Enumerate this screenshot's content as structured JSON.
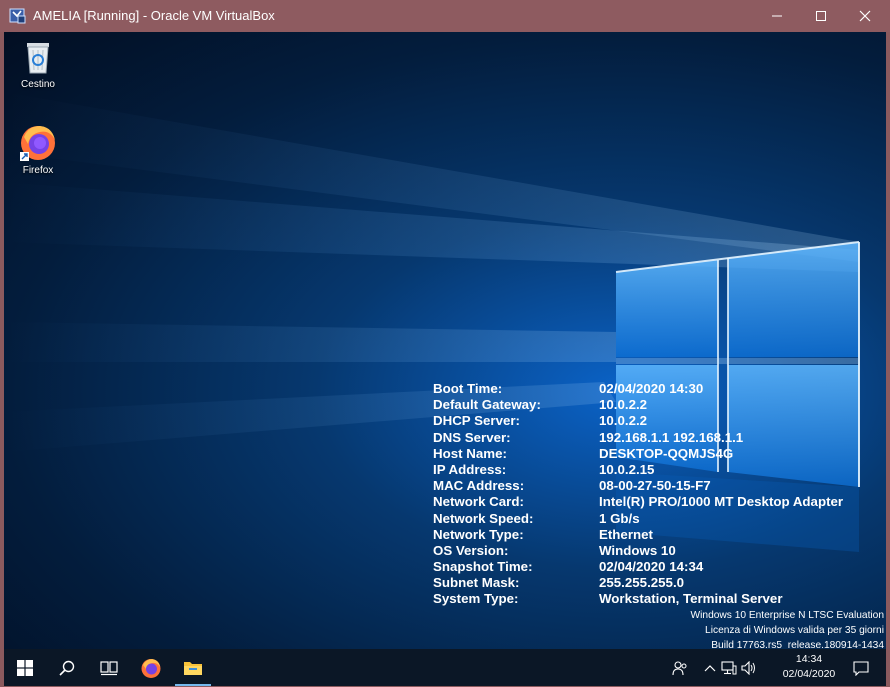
{
  "window": {
    "title": "AMELIA [Running] - Oracle VM VirtualBox",
    "titlebar_color": "#8e5b60"
  },
  "desktop": {
    "icons": [
      {
        "label": "Cestino",
        "icon": "recycle-bin-icon"
      },
      {
        "label": "Firefox",
        "icon": "firefox-icon"
      }
    ]
  },
  "bginfo": {
    "rows": [
      {
        "key": "Boot Time:",
        "value": "02/04/2020 14:30"
      },
      {
        "key": "Default Gateway:",
        "value": "10.0.2.2"
      },
      {
        "key": "DHCP Server:",
        "value": "10.0.2.2"
      },
      {
        "key": "DNS Server:",
        "value": "192.168.1.1 192.168.1.1"
      },
      {
        "key": "Host Name:",
        "value": "DESKTOP-QQMJS4G"
      },
      {
        "key": "IP Address:",
        "value": "10.0.2.15"
      },
      {
        "key": "MAC Address:",
        "value": "08-00-27-50-15-F7"
      },
      {
        "key": "Network Card:",
        "value": "Intel(R) PRO/1000 MT Desktop Adapter"
      },
      {
        "key": "Network Speed:",
        "value": "1 Gb/s"
      },
      {
        "key": "Network Type:",
        "value": "Ethernet"
      },
      {
        "key": "OS Version:",
        "value": "Windows 10"
      },
      {
        "key": "Snapshot Time:",
        "value": "02/04/2020 14:34"
      },
      {
        "key": "Subnet Mask:",
        "value": "255.255.255.0"
      },
      {
        "key": "System Type:",
        "value": "Workstation, Terminal Server"
      }
    ]
  },
  "watermark": {
    "line1": "Windows 10 Enterprise N LTSC Evaluation",
    "line2": "Licenza di Windows valida per 35 giorni",
    "line3": "Build 17763.rs5_release.180914-1434"
  },
  "taskbar": {
    "buttons": [
      "start-icon",
      "search-icon",
      "task-view-icon",
      "firefox-icon",
      "file-explorer-icon"
    ],
    "tray": [
      "people-icon",
      "chevron-up-icon",
      "network-icon",
      "volume-icon",
      "notifications-icon"
    ],
    "clock_time": "14:34",
    "clock_date": "02/04/2020",
    "accent": "#76b9ed"
  }
}
